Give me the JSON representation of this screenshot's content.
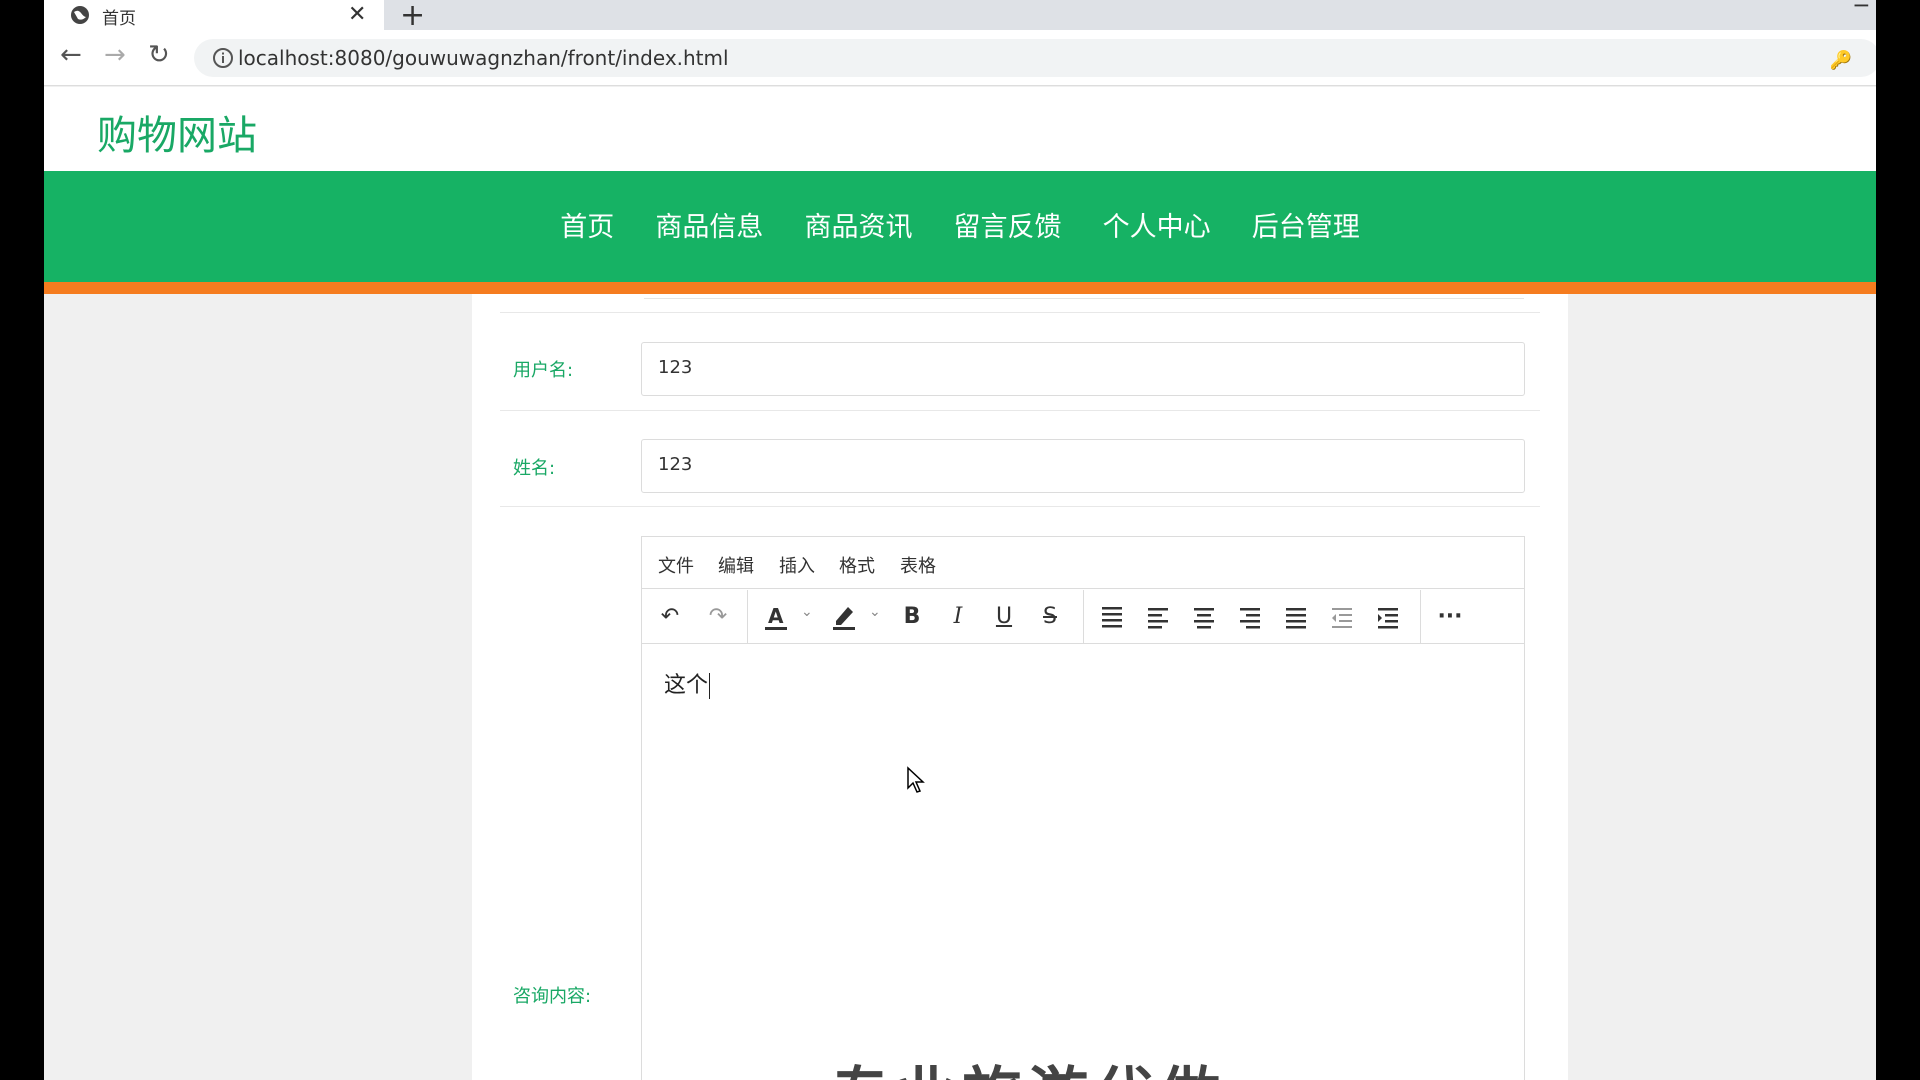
{
  "browser": {
    "tab_title": "首页",
    "tab_close": "✕",
    "new_tab": "+",
    "minimize": "─",
    "back": "←",
    "forward": "→",
    "reload": "↻",
    "url": "localhost:8080/gouwuwagnzhan/front/index.html",
    "key_icon": "🔑"
  },
  "site": {
    "logo": "购物网站",
    "nav": [
      "首页",
      "商品信息",
      "商品资讯",
      "留言反馈",
      "个人中心",
      "后台管理"
    ]
  },
  "form": {
    "username_label": "用户名:",
    "username_value": "123",
    "name_label": "姓名:",
    "name_value": "123",
    "content_label": "咨询内容:"
  },
  "editor": {
    "menu": [
      "文件",
      "编辑",
      "插入",
      "格式",
      "表格"
    ],
    "toolbar": {
      "undo": "↶",
      "redo": "↷",
      "bold": "B",
      "italic": "I",
      "underline": "U",
      "strikethrough": "S",
      "more": "···"
    },
    "content": "这个",
    "partial_image_text": "专业旅游代做"
  },
  "colors": {
    "brand_green": "#16b264",
    "accent_orange": "#f57c1f",
    "label_green": "#19a865"
  }
}
